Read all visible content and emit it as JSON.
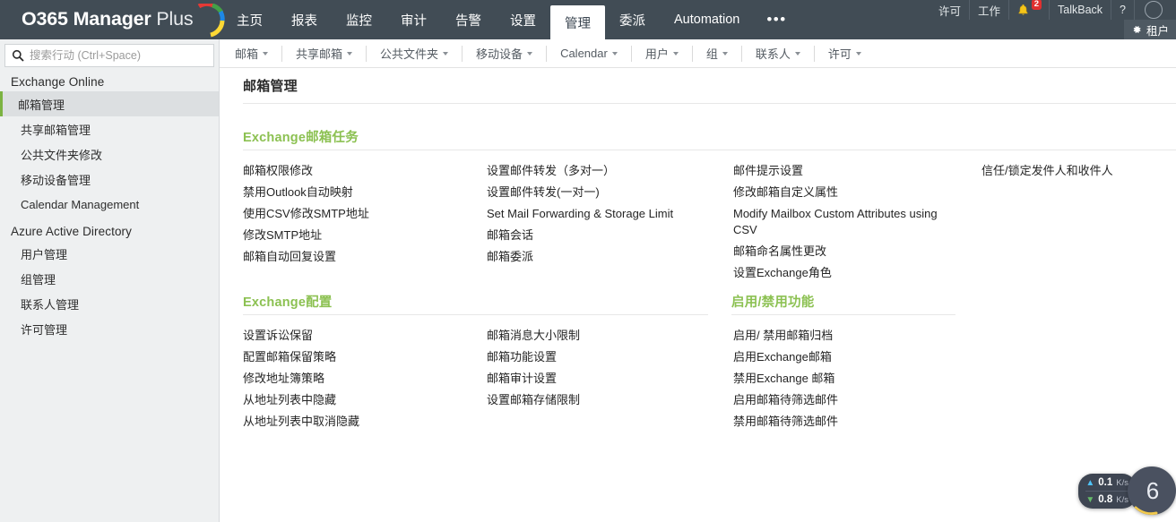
{
  "app": {
    "logo_prefix": "O365 Manager",
    "logo_suffix": " Plus",
    "accent_green": "#8cc152",
    "topbar_bg": "#414c55"
  },
  "topnav": {
    "items": [
      {
        "label": "主页",
        "active": false
      },
      {
        "label": "报表",
        "active": false
      },
      {
        "label": "监控",
        "active": false
      },
      {
        "label": "审计",
        "active": false
      },
      {
        "label": "告警",
        "active": false
      },
      {
        "label": "设置",
        "active": false
      },
      {
        "label": "管理",
        "active": true
      },
      {
        "label": "委派",
        "active": false
      },
      {
        "label": "Automation",
        "active": false
      }
    ],
    "overflow_label": "•••"
  },
  "topright": {
    "license_label": "许可",
    "jobs_label": "工作",
    "notification_icon": "bell-icon",
    "notification_count": "2",
    "talkback_label": "TalkBack",
    "help_label": "?",
    "avatar_icon": "avatar-icon",
    "tenant_label": "租户",
    "tenant_icon": "gear-icon"
  },
  "subnav": {
    "items": [
      {
        "label": "邮箱"
      },
      {
        "label": "共享邮箱"
      },
      {
        "label": "公共文件夹"
      },
      {
        "label": "移动设备"
      },
      {
        "label": "Calendar"
      },
      {
        "label": "用户"
      },
      {
        "label": "组"
      },
      {
        "label": "联系人"
      },
      {
        "label": "许可"
      }
    ]
  },
  "sidebar": {
    "search": {
      "placeholder": "搜索行动 (Ctrl+Space)",
      "value": "",
      "icon": "search-icon"
    },
    "groups": [
      {
        "title": "Exchange Online",
        "items": [
          {
            "label": "邮箱管理",
            "active": true
          },
          {
            "label": "共享邮箱管理",
            "active": false
          },
          {
            "label": "公共文件夹修改",
            "active": false
          },
          {
            "label": "移动设备管理",
            "active": false
          },
          {
            "label": "Calendar Management",
            "active": false
          }
        ]
      },
      {
        "title": "Azure Active Directory",
        "items": [
          {
            "label": "用户管理",
            "active": false
          },
          {
            "label": "组管理",
            "active": false
          },
          {
            "label": "联系人管理",
            "active": false
          },
          {
            "label": "许可管理",
            "active": false
          }
        ]
      }
    ]
  },
  "main": {
    "page_title": "邮箱管理",
    "sections": [
      {
        "title": "Exchange邮箱任务",
        "columns": [
          {
            "tasks": [
              "邮箱权限修改",
              "禁用Outlook自动映射",
              "使用CSV修改SMTP地址",
              "修改SMTP地址",
              "邮箱自动回复设置"
            ]
          },
          {
            "tasks": [
              "设置邮件转发（多对一）",
              "设置邮件转发(一对一)",
              "Set Mail Forwarding & Storage Limit",
              "邮箱会话",
              "邮箱委派"
            ]
          },
          {
            "tasks": [
              "邮件提示设置",
              "修改邮箱自定义属性",
              "Modify Mailbox Custom Attributes using CSV",
              "邮箱命名属性更改",
              "设置Exchange角色"
            ]
          },
          {
            "tasks": [
              "信任/锁定发件人和收件人"
            ]
          }
        ]
      },
      {
        "title": "Exchange配置",
        "columns": [
          {
            "tasks": [
              "设置诉讼保留",
              "配置邮箱保留策略",
              "修改地址簿策略",
              "从地址列表中隐藏",
              "从地址列表中取消隐藏"
            ]
          },
          {
            "tasks": [
              "邮箱消息大小限制",
              "邮箱功能设置",
              "邮箱审计设置",
              "设置邮箱存储限制"
            ]
          }
        ]
      },
      {
        "title": "启用/禁用功能",
        "columns": [
          {
            "tasks": [
              "启用/ 禁用邮箱归档",
              "启用Exchange邮箱",
              "禁用Exchange 邮箱",
              "启用邮箱待筛选邮件",
              "禁用邮箱待筛选邮件"
            ]
          }
        ]
      }
    ]
  },
  "netwidget": {
    "upload_value": "0.1",
    "upload_unit": "K/s",
    "upload_icon": "arrow-up-icon",
    "download_value": "0.8",
    "download_unit": "K/s",
    "download_icon": "arrow-down-icon",
    "gauge_value": "6"
  }
}
